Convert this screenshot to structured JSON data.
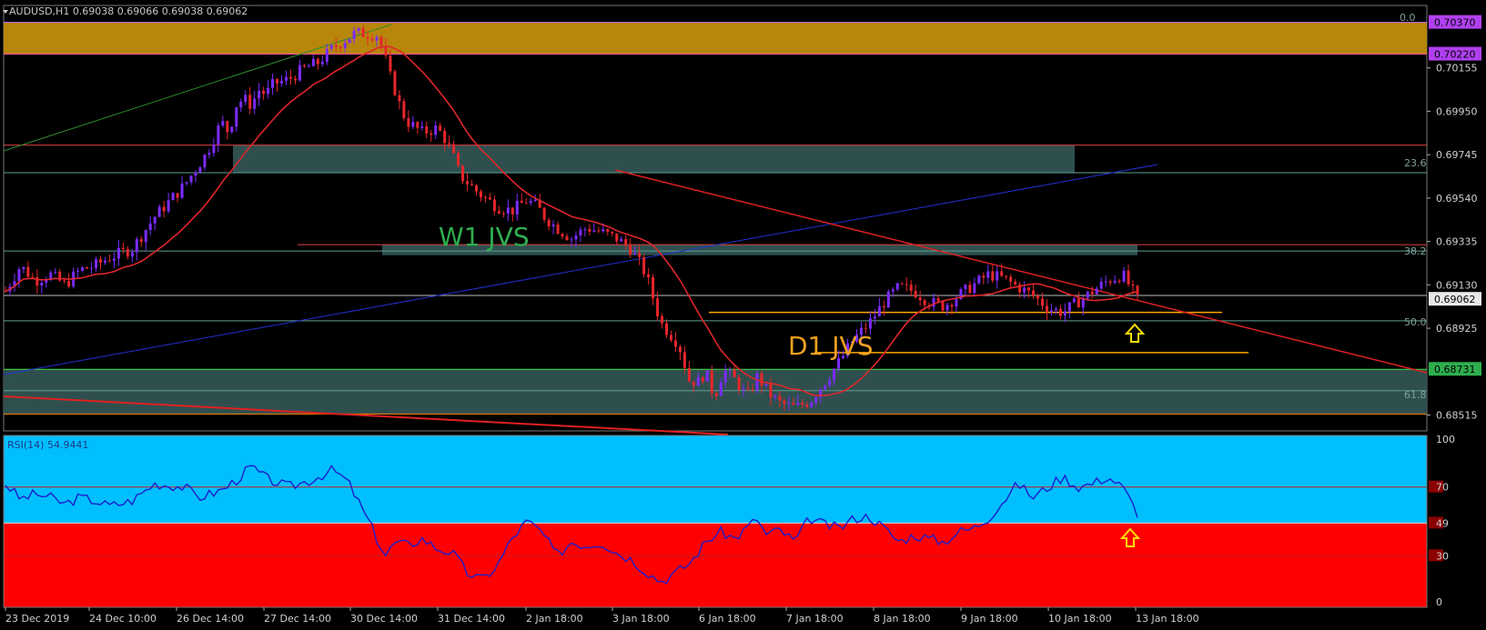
{
  "window": {
    "header": "AUDUSD,H1  0.69038 0.69066 0.69038 0.69062"
  },
  "colors": {
    "background": "#000000",
    "bull_candle": "#7B2CFF",
    "bear_candle": "#E8262B",
    "ma_line": "#E0262B",
    "zone_gold": "#B8860B",
    "zone_teal": "#2F4F4F",
    "rsi_top_band": "#00BFFF",
    "rsi_bottom_band": "#FF0000",
    "rsi_line": "#1E1ECC",
    "text_label_green": "#2EAF4E",
    "text_label_orange": "#F0A020",
    "price_badge_current": "#E8E8E8",
    "price_badge_green": "#2EAF4E",
    "price_badge_purple": "#B040F0",
    "arrow_yellow": "#FFE000"
  },
  "chart_data": [
    {
      "type": "candlestick",
      "symbol": "AUDUSD",
      "timeframe": "H1",
      "title": "AUDUSD,H1  0.69038 0.69066 0.69038 0.69062",
      "ylim": [
        0.6844,
        0.7045
      ],
      "y_ticks": [
        "0.70155",
        "0.69950",
        "0.69745",
        "0.69540",
        "0.69335",
        "0.69130",
        "0.68925",
        "0.68515"
      ],
      "x_ticks": [
        "23 Dec 2019",
        "24 Dec 10:00",
        "26 Dec 14:00",
        "27 Dec 14:00",
        "30 Dec 14:00",
        "31 Dec 14:00",
        "2 Jan 18:00",
        "3 Jan 18:00",
        "6 Jan 18:00",
        "7 Jan 18:00",
        "8 Jan 18:00",
        "9 Jan 18:00",
        "10 Jan 18:00",
        "13 Jan 18:00"
      ],
      "price_badges": [
        {
          "label": "0.70370",
          "style": "purple"
        },
        {
          "label": "0.70220",
          "style": "purple"
        },
        {
          "label": "0.69062",
          "style": "current"
        },
        {
          "label": "0.68731",
          "style": "green"
        }
      ],
      "key_prices": {
        "current": 0.69062,
        "high": 0.7034,
        "low": 0.6851
      },
      "series": [
        {
          "kind": "close-path",
          "x": [
            0,
            10,
            20,
            30,
            40,
            50,
            60,
            70,
            85,
            100,
            120,
            135,
            145,
            150,
            155,
            160,
            165,
            170,
            175,
            180,
            190,
            200,
            210,
            220,
            235,
            250,
            255,
            258,
            262,
            266,
            270,
            280,
            290,
            295,
            300,
            305,
            312,
            320,
            330,
            340,
            350,
            357,
            362,
            370,
            380,
            390,
            400,
            410,
            420,
            430,
            440,
            452,
            459,
            465,
            470,
            476,
            482,
            490,
            498,
            505,
            512,
            520,
            530,
            540,
            553,
            563,
            568
          ],
          "close": [
            0.691,
            0.6922,
            0.6915,
            0.6918,
            0.6913,
            0.692,
            0.6922,
            0.6926,
            0.693,
            0.6945,
            0.696,
            0.6975,
            0.699,
            0.6985,
            0.6998,
            0.7001,
            0.6998,
            0.7005,
            0.7003,
            0.7008,
            0.701,
            0.7015,
            0.7018,
            0.7025,
            0.7032,
            0.7031,
            0.702,
            0.7012,
            0.7004,
            0.6995,
            0.699,
            0.6985,
            0.6987,
            0.6982,
            0.6975,
            0.6965,
            0.696,
            0.6955,
            0.695,
            0.6948,
            0.6953,
            0.695,
            0.6945,
            0.694,
            0.6935,
            0.694,
            0.6938,
            0.6935,
            0.693,
            0.6918,
            0.6895,
            0.6885,
            0.6868,
            0.6867,
            0.6872,
            0.686,
            0.6873,
            0.6868,
            0.686,
            0.687,
            0.6862,
            0.6857,
            0.6855,
            0.6858,
            0.687,
            0.688,
            0.6886
          ]
        },
        {
          "kind": "close-path-2",
          "x": [
            568,
            580,
            590,
            600,
            610,
            620,
            630,
            640,
            650,
            660,
            670,
            680,
            690,
            700,
            710,
            720,
            730,
            740,
            750,
            760
          ],
          "close": [
            0.6886,
            0.6895,
            0.6905,
            0.6912,
            0.691,
            0.6905,
            0.6903,
            0.6908,
            0.6913,
            0.6918,
            0.6916,
            0.6912,
            0.6908,
            0.6902,
            0.69,
            0.6905,
            0.691,
            0.6915,
            0.6918,
            0.6906
          ]
        }
      ],
      "annotations": [
        {
          "label": "W1 JVS",
          "color": "green"
        },
        {
          "label": "D1 JVS",
          "color": "orange"
        },
        {
          "label": "0.0"
        },
        {
          "label": "23.6"
        },
        {
          "label": "38.2"
        },
        {
          "label": "50.0"
        },
        {
          "label": "61.8"
        }
      ]
    },
    {
      "type": "line",
      "title": "RSI(14) 54.9441",
      "ylim": [
        0,
        100
      ],
      "y_ticks": [
        "100",
        "70",
        "49",
        "30",
        "0"
      ],
      "levels": [
        70,
        49,
        30
      ],
      "series": [
        {
          "name": "RSI(14) 54.9441",
          "x": [
            0,
            10,
            20,
            30,
            40,
            50,
            60,
            70,
            85,
            100,
            120,
            130,
            145,
            155,
            165,
            175,
            190,
            205,
            220,
            230,
            245,
            255,
            262,
            270,
            280,
            290,
            300,
            310,
            320,
            330,
            340,
            350,
            360,
            370,
            380,
            390,
            400,
            410,
            420,
            430,
            440,
            450,
            460,
            470,
            480,
            490,
            500,
            505,
            510,
            520,
            530,
            540,
            550,
            560,
            570,
            580,
            590,
            600,
            610,
            620,
            630,
            640,
            650,
            660,
            670,
            680,
            690,
            700,
            710,
            720,
            730,
            740,
            750,
            760
          ],
          "values": [
            72,
            63,
            66,
            64,
            60,
            64,
            62,
            59,
            62,
            72,
            70,
            64,
            68,
            74,
            82,
            75,
            70,
            74,
            80,
            73,
            48,
            30,
            38,
            36,
            40,
            34,
            32,
            20,
            16,
            24,
            40,
            50,
            44,
            30,
            38,
            36,
            38,
            32,
            28,
            21,
            15,
            20,
            26,
            38,
            44,
            40,
            48,
            52,
            42,
            45,
            38,
            52,
            48,
            46,
            52,
            53,
            46,
            38,
            42,
            40,
            38,
            44,
            46,
            52,
            62,
            72,
            64,
            70,
            76,
            70,
            72,
            76,
            70,
            55
          ]
        }
      ]
    }
  ]
}
